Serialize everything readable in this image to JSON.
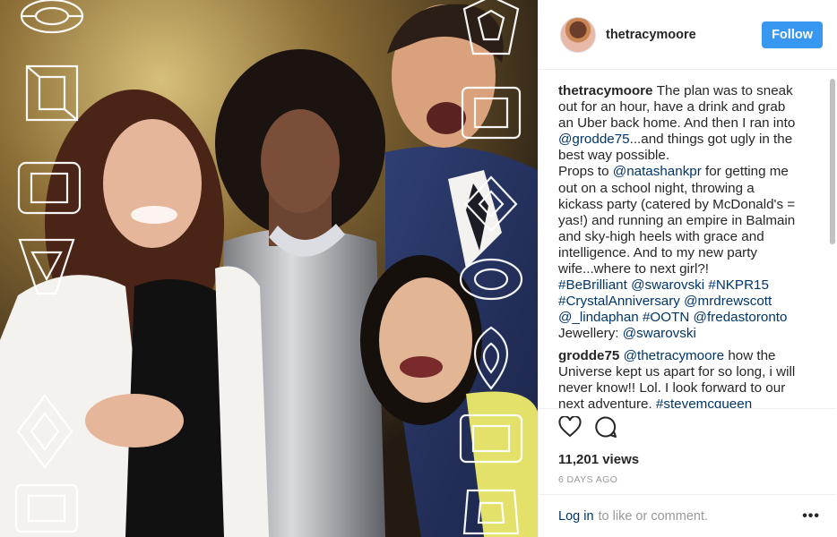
{
  "header": {
    "username": "thetracymoore",
    "follow_label": "Follow"
  },
  "comments": [
    {
      "author": "thetracymoore",
      "lines": [
        [
          {
            "t": "The plan was to sneak"
          }
        ],
        [
          {
            "t": "out for an hour, have a drink and grab"
          }
        ],
        [
          {
            "t": "an Uber back home. And then I ran into"
          }
        ],
        [
          {
            "t": "@grodde75",
            "link": true
          },
          {
            "t": "...and things got ugly in the"
          }
        ],
        [
          {
            "t": "best way possible."
          }
        ],
        [
          {
            "t": "Props to "
          },
          {
            "t": "@natashankpr",
            "link": true
          },
          {
            "t": " for getting me"
          }
        ],
        [
          {
            "t": "out on a school night, throwing a"
          }
        ],
        [
          {
            "t": "kickass party (catered by McDonald's ="
          }
        ],
        [
          {
            "t": "yas!) and running an empire in Balmain"
          }
        ],
        [
          {
            "t": "and sky-high heels with grace and"
          }
        ],
        [
          {
            "t": "intelligence. And to my new party"
          }
        ],
        [
          {
            "t": "wife...where to next girl?!"
          }
        ],
        [
          {
            "t": "#BeBrilliant",
            "link": true
          },
          {
            "t": " "
          },
          {
            "t": "@swarovski",
            "link": true
          },
          {
            "t": " "
          },
          {
            "t": "#NKPR15",
            "link": true
          }
        ],
        [
          {
            "t": "#CrystalAnniversary",
            "link": true
          },
          {
            "t": " "
          },
          {
            "t": "@mrdrewscott",
            "link": true
          }
        ],
        [
          {
            "t": "@_lindaphan",
            "link": true
          },
          {
            "t": " "
          },
          {
            "t": "#OOTN",
            "link": true
          },
          {
            "t": " "
          },
          {
            "t": "@fredastoronto",
            "link": true
          }
        ],
        [
          {
            "t": "Jewellery: "
          },
          {
            "t": "@swarovski",
            "link": true
          }
        ]
      ]
    },
    {
      "author": "grodde75",
      "lines": [
        [
          {
            "t": "@thetracymoore",
            "link": true
          },
          {
            "t": " how the"
          }
        ],
        [
          {
            "t": "Universe kept us apart for so long, i will"
          }
        ],
        [
          {
            "t": "never know!! Lol. I look forward to our"
          }
        ],
        [
          {
            "t": "next adventure. "
          },
          {
            "t": "#stevemcqueen",
            "link": true
          }
        ]
      ]
    }
  ],
  "actions": {
    "like_icon": "heart-outline-icon",
    "comment_icon": "speech-bubble-icon",
    "views": "11,201 views",
    "date": "6 DAYS AGO"
  },
  "footer": {
    "login_label": "Log in",
    "login_suffix": "to like or comment.",
    "more_label": "•••"
  },
  "colors": {
    "follow_button": "#3897f0",
    "link": "#003569",
    "muted": "#999999"
  }
}
